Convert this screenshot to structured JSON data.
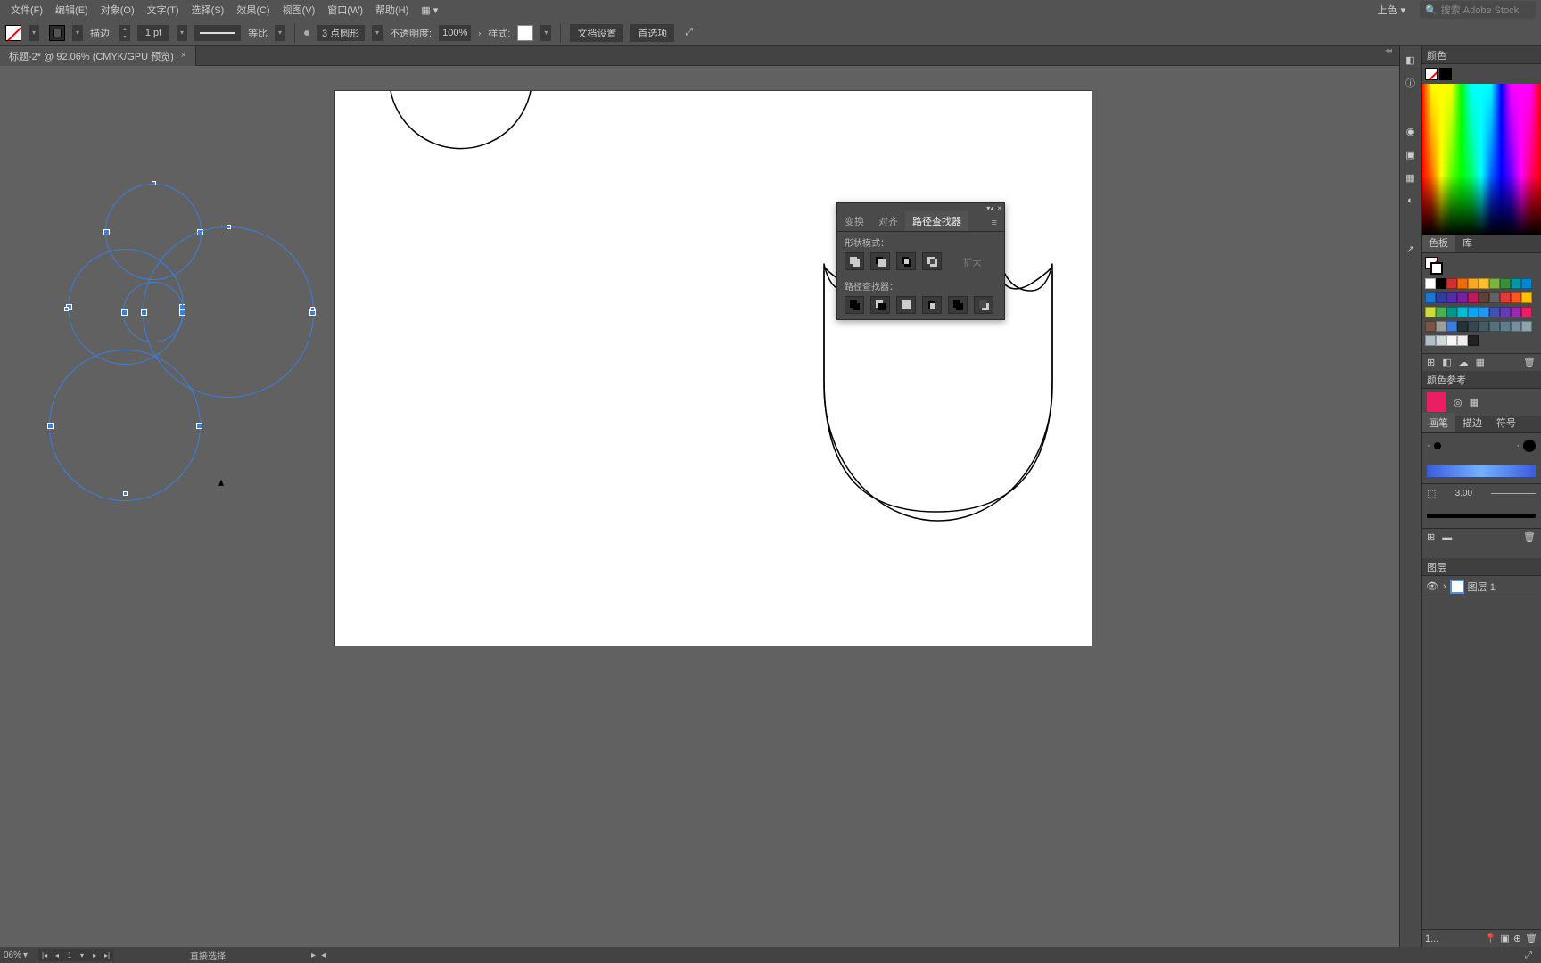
{
  "menu": {
    "file": "文件(F)",
    "edit": "编辑(E)",
    "object": "对象(O)",
    "text": "文字(T)",
    "select": "选择(S)",
    "effect": "效果(C)",
    "view": "视图(V)",
    "window": "窗口(W)",
    "help": "帮助(H)"
  },
  "topright": {
    "coloring": "上色",
    "chev": "▾",
    "search_placeholder": "搜索 Adobe Stock"
  },
  "control": {
    "stroke_lbl": "描边:",
    "stroke_val": "1 pt",
    "profile_lbl": "等比",
    "brush_val": "3 点圆形",
    "opacity_lbl": "不透明度:",
    "opacity_val": "100%",
    "style_lbl": "样式:",
    "docsetup": "文档设置",
    "prefs": "首选项",
    "expand": "⤢"
  },
  "tab": {
    "title": "标题-2* @ 92.06% (CMYK/GPU 预览)",
    "close": "×"
  },
  "pathfinder": {
    "col": "▾▴",
    "close": "×",
    "tab_transform": "变换",
    "tab_align": "对齐",
    "tab_pathfinder": "路径查找器",
    "menu": "≡",
    "shape_modes": "形状模式：",
    "pathfinders": "路径查找器：",
    "expand": "扩大"
  },
  "side": {
    "color": "颜色",
    "swatches": "色板",
    "library": "库",
    "colorguide": "颜色参考",
    "brushes": "画笔",
    "strokes2": "描边",
    "symbols": "符号",
    "layers": "图层",
    "brush_val": "3.00",
    "layer_name": "图层 1",
    "layer_count": "1..."
  },
  "status": {
    "zoom": "06%",
    "zoom_chev": "▾",
    "artnum": "1",
    "tool": "直接选择",
    "play": "▸",
    "rwd": "◂"
  },
  "swatch_colors": [
    "#fff",
    "#000",
    "#d32f2f",
    "#ef6c00",
    "#f9a825",
    "#fbc02d",
    "#7cb342",
    "#388e3c",
    "#0097a7",
    "#0288d1",
    "#1976d2",
    "#303f9f",
    "#512da8",
    "#7b1fa2",
    "#c2185b",
    "#5d4037",
    "#616161",
    "#e53935",
    "#ff5722",
    "#ffc107",
    "#cddc39",
    "#4caf50",
    "#009688",
    "#00bcd4",
    "#03a9f4",
    "#2196f3",
    "#3f51b5",
    "#673ab7",
    "#9c27b0",
    "#e91e63",
    "#795548",
    "#9e9e9e",
    "#3b7fdc",
    "#263238",
    "#37474f",
    "#455a64",
    "#546e7a",
    "#607d8b",
    "#78909c",
    "#90a4ae",
    "#b0bec5",
    "#cfd8dc",
    "#f5f5f5",
    "#eeeeee",
    "#212121"
  ]
}
